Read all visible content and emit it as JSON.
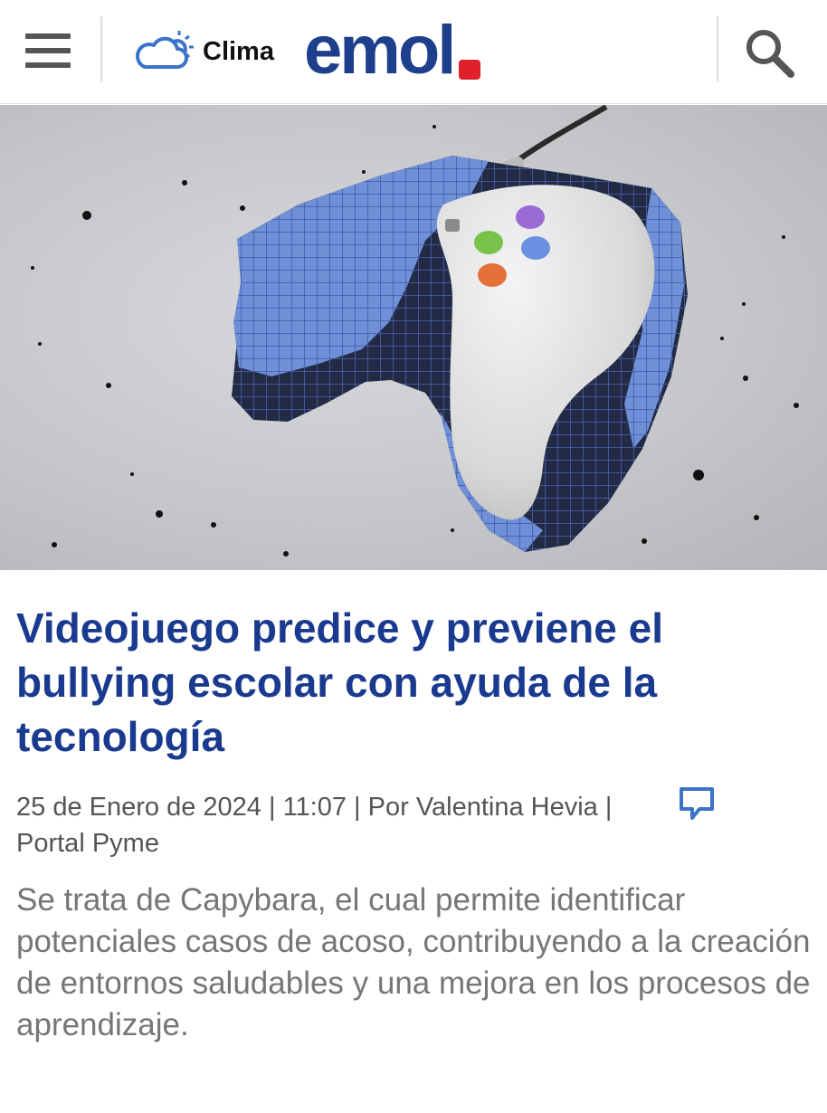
{
  "header": {
    "menu_icon": "hamburger-menu-icon",
    "weather_icon": "cloud-sun-icon",
    "weather_label": "Clima",
    "logo_text": "emol",
    "search_icon": "search-icon",
    "brand_color": "#1d3f8c",
    "logo_accent": "#e0202a"
  },
  "hero": {
    "image": "gamepad-pixel-render"
  },
  "article": {
    "title": "Videojuego predice y previene el bullying escolar con ayuda de la tecnología",
    "date": "25 de Enero de 2024",
    "time": "11:07",
    "author": "Por Valentina Hevia",
    "section": "Portal Pyme",
    "comment_icon": "comment-icon",
    "summary": "Se trata de Capybara, el cual permite identificar potenciales casos de acoso, contribuyendo a la creación de entornos saludables y una mejora en los procesos de aprendizaje.",
    "title_color": "#1a3a8f"
  }
}
